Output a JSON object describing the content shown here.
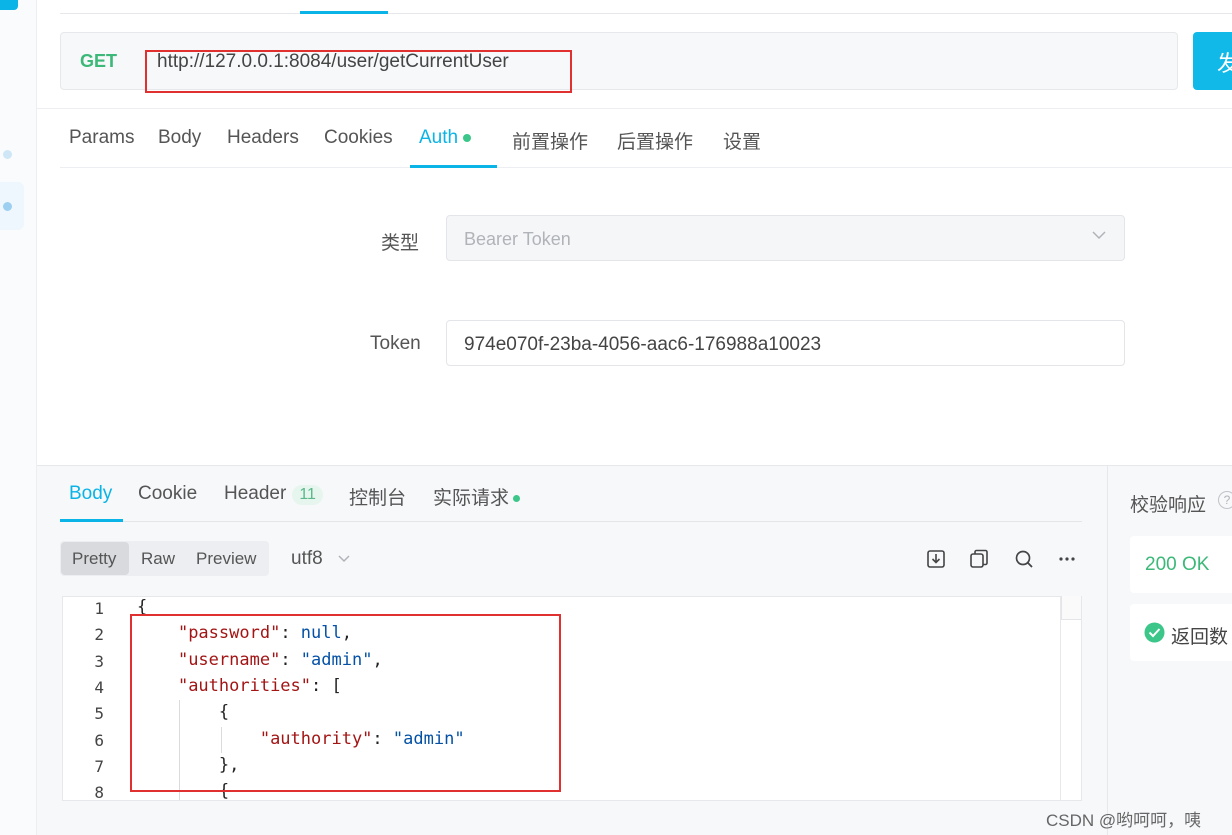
{
  "request": {
    "method": "GET",
    "url": "http://127.0.0.1:8084/user/getCurrentUser",
    "send_label": "发"
  },
  "request_tabs": [
    {
      "label": "Params"
    },
    {
      "label": "Body"
    },
    {
      "label": "Headers"
    },
    {
      "label": "Cookies"
    },
    {
      "label": "Auth",
      "active": true
    },
    {
      "label": "前置操作"
    },
    {
      "label": "后置操作"
    },
    {
      "label": "设置"
    }
  ],
  "auth": {
    "type_label": "类型",
    "type_value": "Bearer Token",
    "token_label": "Token",
    "token_value": "974e070f-23ba-4056-aac6-176988a10023"
  },
  "response_tabs": [
    {
      "label": "Body",
      "active": true
    },
    {
      "label": "Cookie"
    },
    {
      "label": "Header",
      "badge": "11"
    },
    {
      "label": "控制台"
    },
    {
      "label": "实际请求"
    }
  ],
  "format": {
    "options": [
      "Pretty",
      "Raw",
      "Preview"
    ],
    "selected": "Pretty",
    "encoding": "utf8"
  },
  "toolbar_icons": [
    "download-icon",
    "copy-icon",
    "search-icon",
    "more-icon"
  ],
  "code_lines": [
    {
      "n": "1",
      "text": "{"
    },
    {
      "n": "2",
      "text": "    \"password\": null,"
    },
    {
      "n": "3",
      "text": "    \"username\": \"admin\","
    },
    {
      "n": "4",
      "text": "    \"authorities\": ["
    },
    {
      "n": "5",
      "text": "        {"
    },
    {
      "n": "6",
      "text": "            \"authority\": \"admin\""
    },
    {
      "n": "7",
      "text": "        },"
    },
    {
      "n": "8",
      "text": "        {"
    }
  ],
  "verify": {
    "title": "校验响应",
    "help": "?",
    "status": "200 OK",
    "return_label": "返回数"
  },
  "watermark": "CSDN @哟呵呵，咦",
  "colors": {
    "accent": "#0bb4e6",
    "method_get": "#3cb878",
    "highlight_box": "#e0302f",
    "success": "#3cc68a"
  }
}
